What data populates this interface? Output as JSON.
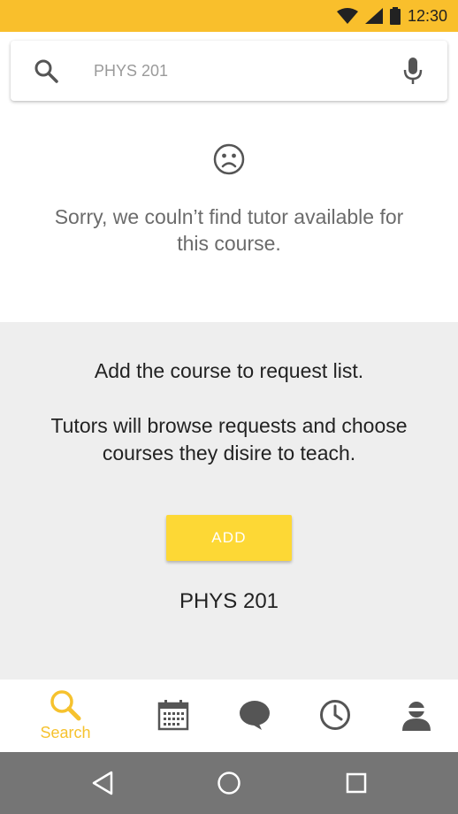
{
  "status_bar": {
    "time": "12:30",
    "color": "#f9bf2c",
    "icons": [
      "wifi-icon",
      "cellular-signal-icon",
      "battery-icon"
    ]
  },
  "search": {
    "query": "PHYS 201",
    "icons": [
      "search-icon",
      "mic-icon"
    ]
  },
  "empty_state": {
    "icon": "sad-face-icon",
    "message": "Sorry, we couln’t find tutor available for this course."
  },
  "request_panel": {
    "line1": "Add the course to request list.",
    "line2": "Tutors will browse requests and choose courses they disire to teach.",
    "add_button_label": "ADD",
    "course_code": "PHYS 201",
    "button_color": "#fdd835"
  },
  "bottom_nav": {
    "active": "search",
    "active_color": "#f6c22e",
    "items": [
      {
        "id": "search",
        "label": "Search",
        "icon": "search-icon"
      },
      {
        "id": "calendar",
        "icon": "calendar-icon"
      },
      {
        "id": "chat",
        "icon": "chat-bubble-icon"
      },
      {
        "id": "history",
        "icon": "clock-icon"
      },
      {
        "id": "profile",
        "icon": "profile-icon"
      }
    ]
  },
  "system_nav": {
    "icons": [
      "back-triangle-icon",
      "home-circle-icon",
      "recents-square-icon"
    ]
  }
}
